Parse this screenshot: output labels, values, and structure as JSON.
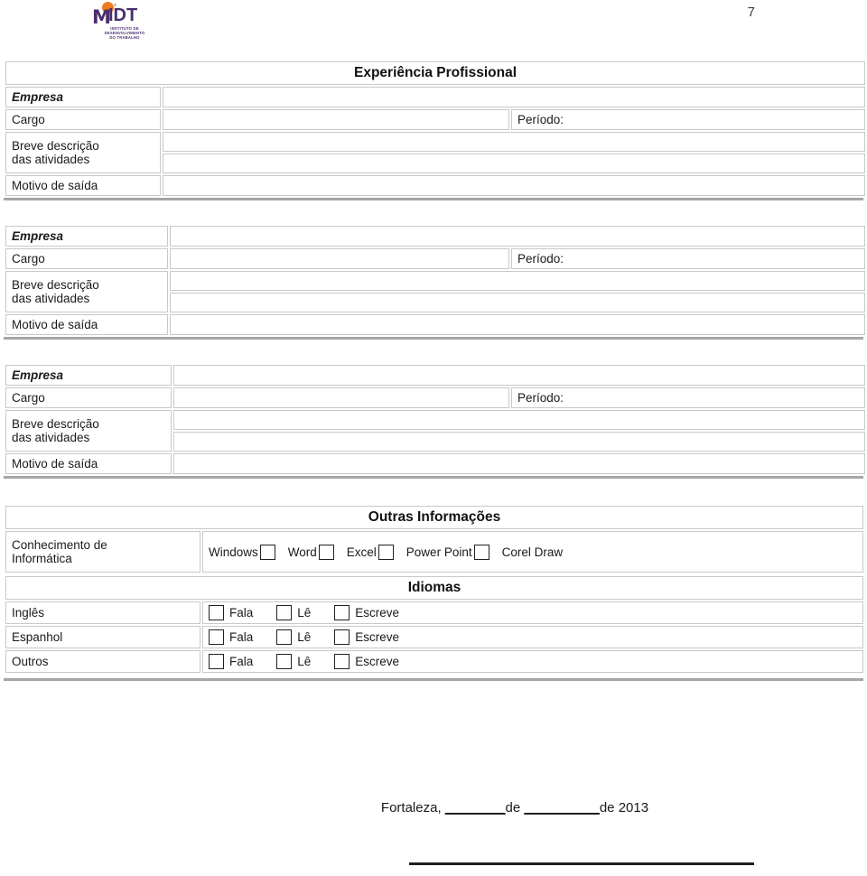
{
  "page": {
    "number": "7",
    "logo": {
      "acronym": "IDT",
      "subtitle_line1": "INSTITUTO DE",
      "subtitle_line2": "DESENVOLVIMENTO",
      "subtitle_line3": "DO TRABALHO",
      "trademark": "®",
      "dot_color": "#f07c22",
      "text_color": "#4a2d6e"
    }
  },
  "experience": {
    "section_title": "Experiência Profissional",
    "labels": {
      "empresa": "Empresa",
      "cargo": "Cargo",
      "periodo": "Período:",
      "descricao_line1": "Breve descrição",
      "descricao_line2": "das atividades",
      "motivo": "Motivo de saída"
    },
    "entries": [
      {
        "empresa": "",
        "cargo": "",
        "periodo": "",
        "descricao_a": "",
        "descricao_b": "",
        "motivo": ""
      },
      {
        "empresa": "",
        "cargo": "",
        "periodo": "",
        "descricao_a": "",
        "descricao_b": "",
        "motivo": ""
      },
      {
        "empresa": "",
        "cargo": "",
        "periodo": "",
        "descricao_a": "",
        "descricao_b": "",
        "motivo": ""
      }
    ]
  },
  "other_info": {
    "section_title": "Outras Informações",
    "computing": {
      "label_line1": "Conhecimento de",
      "label_line2": "Informática",
      "skills": [
        "Windows",
        "Word",
        "Excel",
        "Power Point",
        "Corel Draw"
      ]
    }
  },
  "languages": {
    "section_title": "Idiomas",
    "skill_labels": [
      "Fala",
      "Lê",
      "Escreve"
    ],
    "rows": [
      "Inglês",
      "Espanhol",
      "Outros"
    ]
  },
  "footer": {
    "city": "Fortaleza,",
    "blank1": "________",
    "de1": "de",
    "blank2": "__________",
    "de2": "de 2013"
  }
}
